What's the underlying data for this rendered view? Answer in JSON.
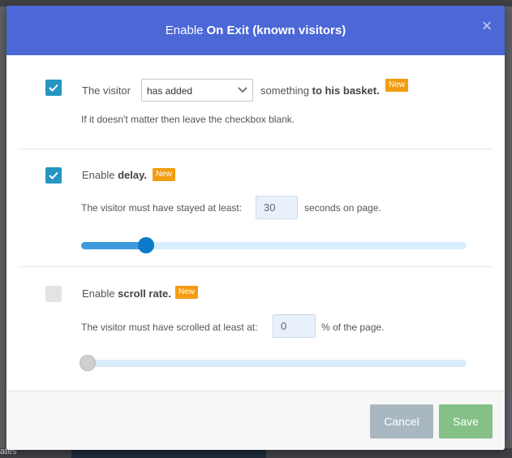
{
  "background": {
    "partial_text": "ates"
  },
  "modal": {
    "title_prefix": "Enable",
    "title_strong": "On Exit (known visitors)",
    "close_glyph": "×"
  },
  "basket": {
    "checked": true,
    "prefix": "The visitor",
    "select_value": "has added",
    "suffix_plain": "something",
    "suffix_strong": "to his basket.",
    "badge": "New",
    "hint": "If it doesn't matter then leave the checkbox blank."
  },
  "delay": {
    "checked": true,
    "label_plain": "Enable",
    "label_strong": "delay.",
    "badge": "New",
    "text_before": "The visitor must have stayed at least:",
    "value": "30",
    "text_after": "seconds on page.",
    "slider_fraction": 0.16
  },
  "scroll": {
    "checked": false,
    "label_plain": "Enable",
    "label_strong": "scroll rate.",
    "badge": "New",
    "text_before": "The visitor must have scrolled at least at:",
    "value": "0",
    "text_after": "% of the page.",
    "slider_fraction": 0
  },
  "footer": {
    "cancel_label": "Cancel",
    "save_label": "Save"
  },
  "colors": {
    "header": "#4b68d6",
    "checkbox_checked": "#2596c4",
    "badge": "#f39c12",
    "slider_fill": "#3d9bdd",
    "cancel": "#a9b7c0",
    "save": "#84c087"
  }
}
